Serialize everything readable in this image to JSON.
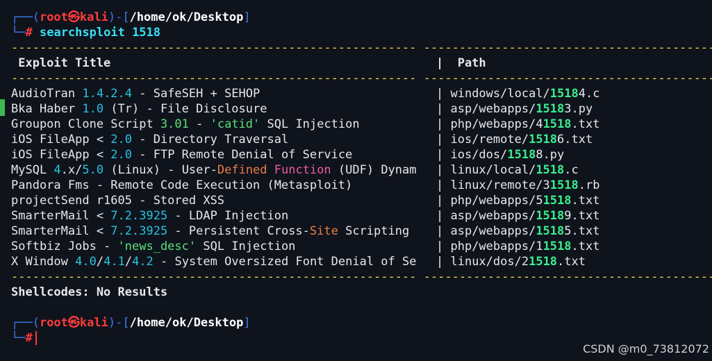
{
  "prompt1": {
    "corner_top": "┌──(",
    "user": "root",
    "skull": "㉿",
    "host": "kali",
    "mid": ")-[",
    "path": "/home/ok/Desktop",
    "end": "]",
    "corner_bottom": "└─",
    "hash": "#"
  },
  "command": {
    "name": "searchsploit",
    "arg": "1518"
  },
  "dashes": {
    "left": "---------------------------------------------------------",
    "right": "-----------------------------------------"
  },
  "headers": {
    "title": " Exploit Title",
    "path": "|  Path"
  },
  "rows": [
    {
      "segments": [
        {
          "t": "AudioTran ",
          "c": ""
        },
        {
          "t": "1.4.2.4",
          "c": "cyan"
        },
        {
          "t": " - SafeSEH + SEHOP",
          "c": ""
        }
      ],
      "path": [
        {
          "t": "windows/local/",
          "c": ""
        },
        {
          "t": "1518",
          "c": "green-b"
        },
        {
          "t": "4.c",
          "c": ""
        }
      ]
    },
    {
      "segments": [
        {
          "t": "Bka Haber ",
          "c": ""
        },
        {
          "t": "1.0",
          "c": "cyan"
        },
        {
          "t": " (Tr) - File Disclosure",
          "c": ""
        }
      ],
      "path": [
        {
          "t": "asp/webapps/",
          "c": ""
        },
        {
          "t": "1518",
          "c": "green-b"
        },
        {
          "t": "3.py",
          "c": ""
        }
      ]
    },
    {
      "segments": [
        {
          "t": "Groupon Clone Script ",
          "c": ""
        },
        {
          "t": "3.01",
          "c": "green"
        },
        {
          "t": " - ",
          "c": ""
        },
        {
          "t": "'catid'",
          "c": "green"
        },
        {
          "t": " SQL Injection",
          "c": ""
        }
      ],
      "path": [
        {
          "t": "php/webapps/",
          "c": ""
        },
        {
          "t": "4",
          "c": ""
        },
        {
          "t": "1518",
          "c": "green-b"
        },
        {
          "t": ".txt",
          "c": ""
        }
      ]
    },
    {
      "segments": [
        {
          "t": "iOS FileApp < ",
          "c": ""
        },
        {
          "t": "2.0",
          "c": "cyan"
        },
        {
          "t": " - Directory Traversal",
          "c": ""
        }
      ],
      "path": [
        {
          "t": "ios/remote/",
          "c": ""
        },
        {
          "t": "1518",
          "c": "green-b"
        },
        {
          "t": "6.txt",
          "c": ""
        }
      ]
    },
    {
      "segments": [
        {
          "t": "iOS FileApp < ",
          "c": ""
        },
        {
          "t": "2.0",
          "c": "cyan"
        },
        {
          "t": " - FTP Remote Denial of Service",
          "c": ""
        }
      ],
      "path": [
        {
          "t": "ios/dos/",
          "c": ""
        },
        {
          "t": "1518",
          "c": "green-b"
        },
        {
          "t": "8.py",
          "c": ""
        }
      ]
    },
    {
      "segments": [
        {
          "t": "MySQL ",
          "c": ""
        },
        {
          "t": "4",
          "c": "cyan"
        },
        {
          "t": ".x/",
          "c": ""
        },
        {
          "t": "5.0",
          "c": "cyan"
        },
        {
          "t": " (Linux) - User-",
          "c": ""
        },
        {
          "t": "Defined",
          "c": "orange"
        },
        {
          "t": " ",
          "c": ""
        },
        {
          "t": "Function",
          "c": "pink"
        },
        {
          "t": " (UDF) Dynam",
          "c": ""
        }
      ],
      "path": [
        {
          "t": "linux/local/",
          "c": ""
        },
        {
          "t": "1518",
          "c": "green-b"
        },
        {
          "t": ".c",
          "c": ""
        }
      ]
    },
    {
      "segments": [
        {
          "t": "Pandora Fms - Remote Code Execution (Metasploit)",
          "c": ""
        }
      ],
      "path": [
        {
          "t": "linux/remote/",
          "c": ""
        },
        {
          "t": "3",
          "c": ""
        },
        {
          "t": "1518",
          "c": "green-b"
        },
        {
          "t": ".rb",
          "c": ""
        }
      ]
    },
    {
      "segments": [
        {
          "t": "projectSend r1605 - Stored XSS",
          "c": ""
        }
      ],
      "path": [
        {
          "t": "php/webapps/",
          "c": ""
        },
        {
          "t": "5",
          "c": ""
        },
        {
          "t": "1518",
          "c": "green-b"
        },
        {
          "t": ".txt",
          "c": ""
        }
      ]
    },
    {
      "segments": [
        {
          "t": "SmarterMail < ",
          "c": ""
        },
        {
          "t": "7.2.3925",
          "c": "cyan"
        },
        {
          "t": " - LDAP Injection",
          "c": ""
        }
      ],
      "path": [
        {
          "t": "asp/webapps/",
          "c": ""
        },
        {
          "t": "1518",
          "c": "green-b"
        },
        {
          "t": "9.txt",
          "c": ""
        }
      ]
    },
    {
      "segments": [
        {
          "t": "SmarterMail < ",
          "c": ""
        },
        {
          "t": "7.2.3925",
          "c": "cyan"
        },
        {
          "t": " - Persistent Cross-",
          "c": ""
        },
        {
          "t": "Site",
          "c": "orange"
        },
        {
          "t": " Scripting",
          "c": ""
        }
      ],
      "path": [
        {
          "t": "asp/webapps/",
          "c": ""
        },
        {
          "t": "1518",
          "c": "green-b"
        },
        {
          "t": "5.txt",
          "c": ""
        }
      ]
    },
    {
      "segments": [
        {
          "t": "Softbiz Jobs - ",
          "c": ""
        },
        {
          "t": "'news_desc'",
          "c": "green"
        },
        {
          "t": " SQL Injection",
          "c": ""
        }
      ],
      "path": [
        {
          "t": "php/webapps/",
          "c": ""
        },
        {
          "t": "1",
          "c": ""
        },
        {
          "t": "1518",
          "c": "green-b"
        },
        {
          "t": ".txt",
          "c": ""
        }
      ]
    },
    {
      "segments": [
        {
          "t": "X Window ",
          "c": ""
        },
        {
          "t": "4.0",
          "c": "cyan"
        },
        {
          "t": "/",
          "c": ""
        },
        {
          "t": "4.1",
          "c": "cyan"
        },
        {
          "t": "/",
          "c": ""
        },
        {
          "t": "4.2",
          "c": "cyan"
        },
        {
          "t": " - System Oversized Font Denial of Se",
          "c": ""
        }
      ],
      "path": [
        {
          "t": "linux/dos/",
          "c": ""
        },
        {
          "t": "2",
          "c": ""
        },
        {
          "t": "1518",
          "c": "green-b"
        },
        {
          "t": ".txt",
          "c": ""
        }
      ]
    }
  ],
  "shellcodes": "Shellcodes: No Results",
  "watermark": "CSDN @m0_73812072",
  "colors": {
    "background": "#0f131c",
    "prompt_blue": "#3f79ec",
    "prompt_red": "#ff3b3b",
    "number_cyan": "#27c3df",
    "match_green": "#39ee8e",
    "dash_yellow": "#f2d54a"
  }
}
